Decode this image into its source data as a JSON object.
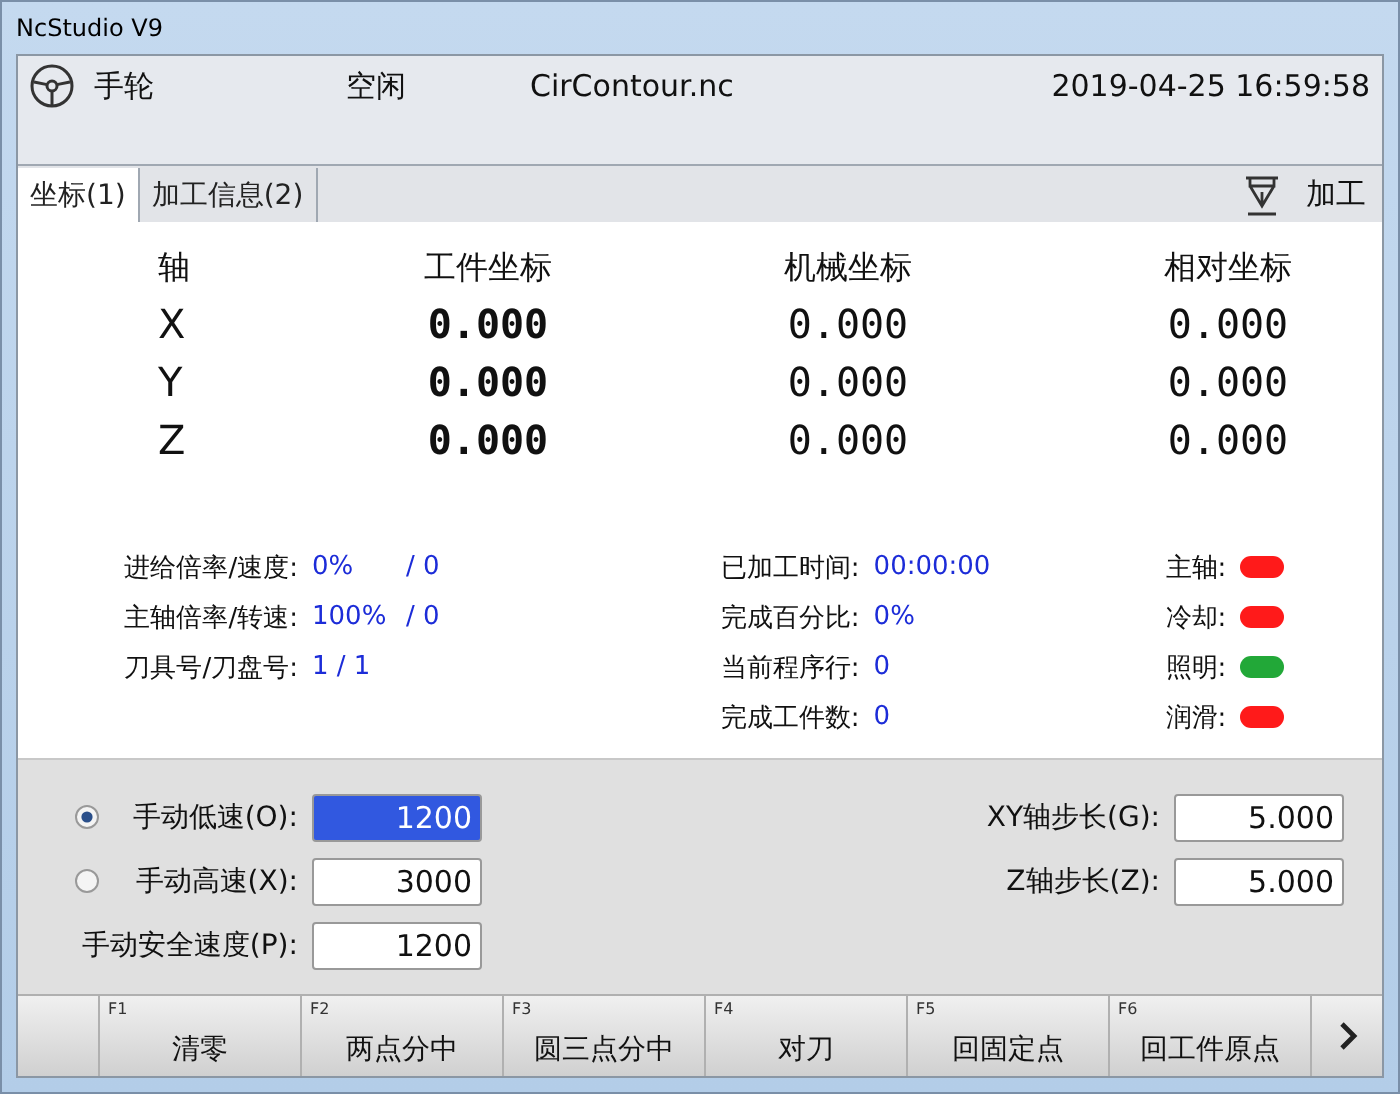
{
  "window": {
    "title": "NcStudio V9"
  },
  "header": {
    "mode": "手轮",
    "state": "空闲",
    "file": "CirContour.nc",
    "datetime": "2019-04-25 16:59:58"
  },
  "tabs": [
    {
      "label": "坐标(1)",
      "selected": true
    },
    {
      "label": "加工信息(2)",
      "selected": false
    }
  ],
  "process_button": "加工",
  "coordinates": {
    "columns": [
      "轴",
      "工件坐标",
      "机械坐标",
      "相对坐标"
    ],
    "rows": [
      {
        "axis": "X",
        "work": "0.000",
        "machine": "0.000",
        "relative": "0.000"
      },
      {
        "axis": "Y",
        "work": "0.000",
        "machine": "0.000",
        "relative": "0.000"
      },
      {
        "axis": "Z",
        "work": "0.000",
        "machine": "0.000",
        "relative": "0.000"
      }
    ]
  },
  "status_left": [
    {
      "label": "进给倍率/速度:",
      "values": [
        "0%",
        "/ 0"
      ]
    },
    {
      "label": "主轴倍率/转速:",
      "values": [
        "100%",
        "/ 0"
      ]
    },
    {
      "label": "刀具号/刀盘号:",
      "values": [
        "1 / 1"
      ]
    }
  ],
  "status_middle": [
    {
      "label": "已加工时间:",
      "value": "00:00:00"
    },
    {
      "label": "完成百分比:",
      "value": "0%"
    },
    {
      "label": "当前程序行:",
      "value": "0"
    },
    {
      "label": "完成工件数:",
      "value": "0"
    }
  ],
  "indicators": [
    {
      "label": "主轴:",
      "color": "#ff1a1a"
    },
    {
      "label": "冷却:",
      "color": "#ff1a1a"
    },
    {
      "label": "照明:",
      "color": "#22a838"
    },
    {
      "label": "润滑:",
      "color": "#ff1a1a"
    }
  ],
  "manual_speeds": [
    {
      "kind": "radio",
      "label": "手动低速(O):",
      "value": "1200",
      "selected": true,
      "highlighted": true
    },
    {
      "kind": "radio",
      "label": "手动高速(X):",
      "value": "3000",
      "selected": false,
      "highlighted": false
    },
    {
      "kind": "field",
      "label": "手动安全速度(P):",
      "value": "1200",
      "highlighted": false
    }
  ],
  "step_sizes": [
    {
      "label": "XY轴步长(G):",
      "value": "5.000"
    },
    {
      "label": "Z轴步长(Z):",
      "value": "5.000"
    }
  ],
  "function_keys": [
    {
      "key": "F1",
      "label": "清零"
    },
    {
      "key": "F2",
      "label": "两点分中"
    },
    {
      "key": "F3",
      "label": "圆三点分中"
    },
    {
      "key": "F4",
      "label": "对刀"
    },
    {
      "key": "F5",
      "label": "回固定点"
    },
    {
      "key": "F6",
      "label": "回工件原点"
    }
  ]
}
